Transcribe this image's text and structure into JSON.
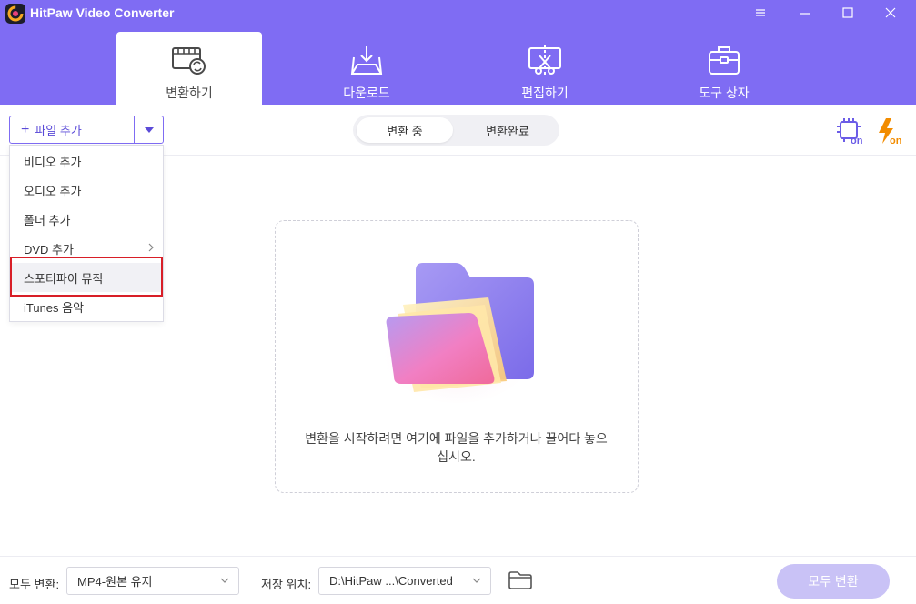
{
  "app": {
    "title": "HitPaw Video Converter"
  },
  "tabs": [
    {
      "label": "변환하기",
      "icon": "film-convert-icon",
      "active": true
    },
    {
      "label": "다운로드",
      "icon": "download-tray-icon",
      "active": false
    },
    {
      "label": "편집하기",
      "icon": "edit-scissors-icon",
      "active": false
    },
    {
      "label": "도구 상자",
      "icon": "toolbox-icon",
      "active": false
    }
  ],
  "toolbar": {
    "add_file_label": "파일 추가",
    "segments": [
      {
        "label": "변환 중",
        "active": true
      },
      {
        "label": "변환완료",
        "active": false
      }
    ]
  },
  "add_menu": {
    "items": [
      {
        "label": "비디오 추가"
      },
      {
        "label": "오디오 추가"
      },
      {
        "label": "폴더 추가"
      },
      {
        "label": "DVD 추가",
        "submenu": true
      },
      {
        "label": "스포티파이 뮤직",
        "highlighted": true
      },
      {
        "label": "iTunes 음악"
      }
    ]
  },
  "dropzone": {
    "text": "변환을 시작하려면 여기에 파일을 추가하거나 끌어다 놓으십시오."
  },
  "bottom": {
    "convert_all_label": "모두 변환:",
    "format_value": "MP4-원본 유지",
    "save_label": "저장 위치:",
    "save_path": "D:\\HitPaw ...\\Converted",
    "convert_all_button": "모두 변환"
  },
  "colors": {
    "header": "#7f6cf3",
    "accent": "#5b4bd8",
    "highlight_border": "#d81e27",
    "hw_accel_icon": "#6b5ce7",
    "turbo_icon": "#f28c00",
    "convert_all_disabled": "#c9c2f6"
  }
}
